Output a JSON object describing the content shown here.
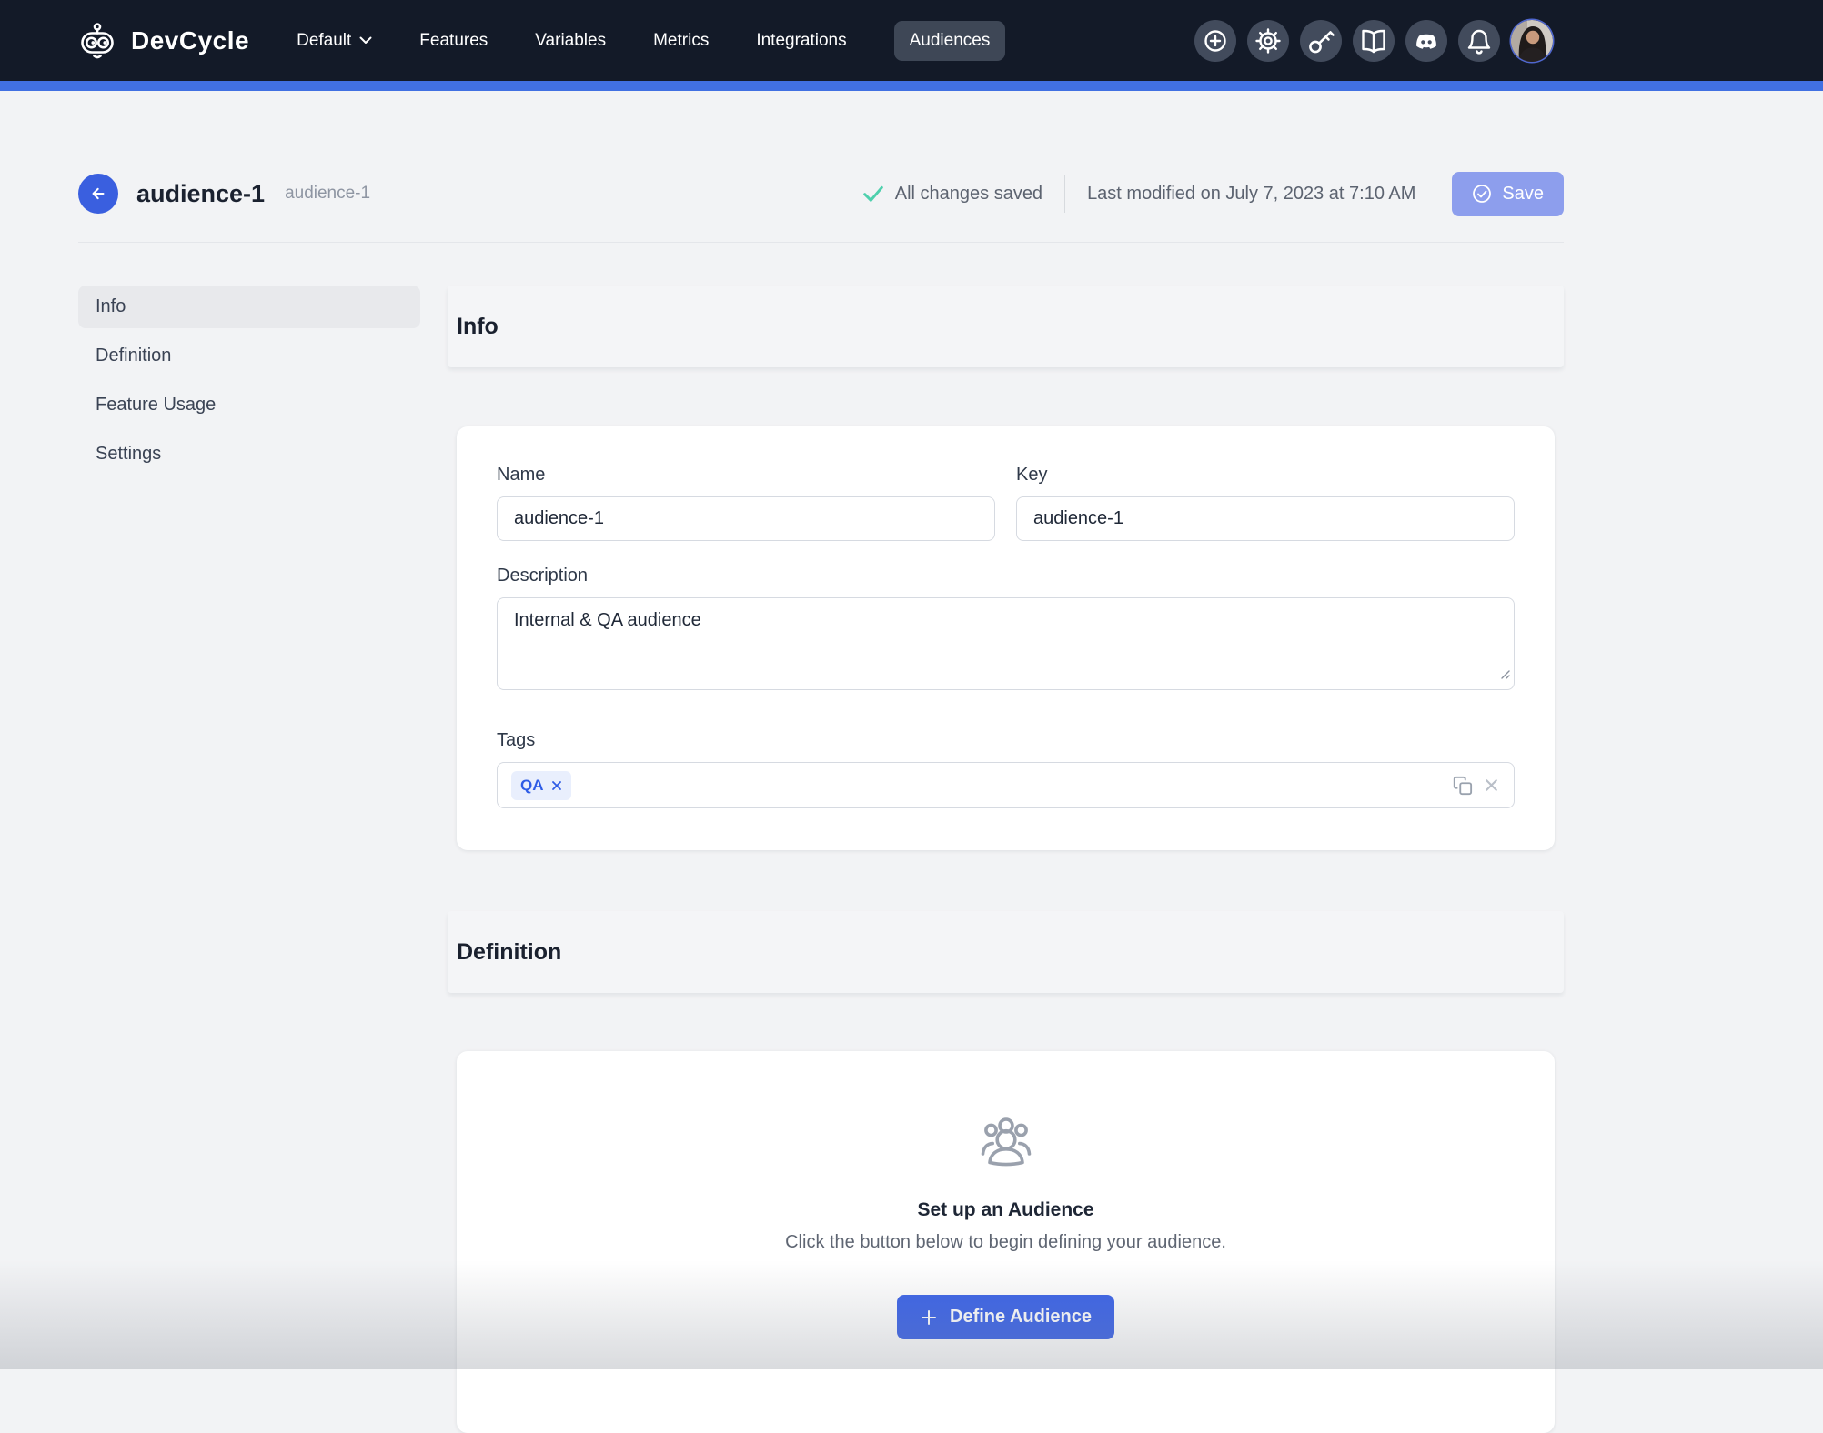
{
  "colors": {
    "navbar_bg": "#131a28",
    "accent_blue": "#3b63e8",
    "top_accent_bar": "#4170e2",
    "save_button_disabled": "#8d9eed",
    "success_check": "#4ed0ad",
    "tag_chip_bg": "#e9effd",
    "tag_chip_text": "#2e5ce6",
    "page_bg": "#f2f3f5"
  },
  "navbar": {
    "brand": "DevCycle",
    "project_selector": "Default",
    "items": [
      {
        "label": "Features",
        "active": false
      },
      {
        "label": "Variables",
        "active": false
      },
      {
        "label": "Metrics",
        "active": false
      },
      {
        "label": "Integrations",
        "active": false
      },
      {
        "label": "Audiences",
        "active": true
      }
    ],
    "icon_buttons": [
      "create",
      "settings",
      "api-keys",
      "documentation",
      "discord",
      "notifications"
    ]
  },
  "header": {
    "title": "audience-1",
    "subtitle": "audience-1",
    "status_text": "All changes saved",
    "last_modified": "Last modified on July 7, 2023 at 7:10 AM",
    "save_label": "Save"
  },
  "sidebar": {
    "items": [
      {
        "label": "Info",
        "active": true
      },
      {
        "label": "Definition",
        "active": false
      },
      {
        "label": "Feature Usage",
        "active": false
      },
      {
        "label": "Settings",
        "active": false
      }
    ]
  },
  "info_section": {
    "heading": "Info",
    "fields": {
      "name": {
        "label": "Name",
        "value": "audience-1"
      },
      "key": {
        "label": "Key",
        "value": "audience-1"
      },
      "description": {
        "label": "Description",
        "value": "Internal & QA audience"
      },
      "tags": {
        "label": "Tags",
        "values": [
          "QA"
        ]
      }
    }
  },
  "definition_section": {
    "heading": "Definition",
    "empty_state": {
      "title": "Set up an Audience",
      "subtitle": "Click the button below to begin defining your audience.",
      "button_label": "Define Audience"
    }
  }
}
